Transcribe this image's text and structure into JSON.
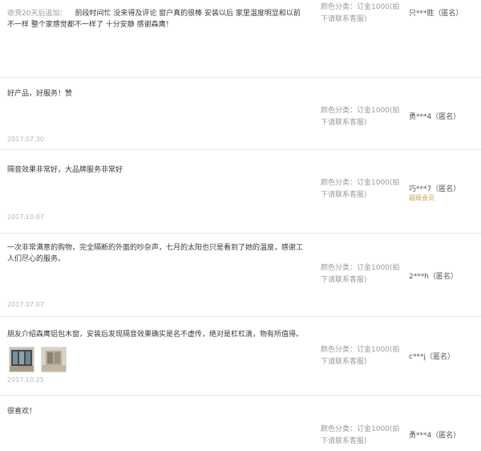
{
  "reviews": [
    {
      "appended_label": "收货20天后追加：",
      "comment": "前段时间忙 没来得及评论 窗户真的很棒 安装以后 家里温度明显和以前不一样 整个家感觉都不一样了 十分安静 感谢森鹰！",
      "sku": "颜色分类：订金1000(拍下请联系客服)",
      "user": "只***胜（匿名）"
    },
    {
      "comment": "好产品，好服务！赞",
      "date": "2017.07.30",
      "sku": "颜色分类：订金1000(拍下请联系客服)",
      "user": "勇***4（匿名）"
    },
    {
      "comment": "隔音效果非常好，大品牌服务非常好",
      "date": "2017.10.07",
      "sku": "颜色分类：订金1000(拍下请联系客服)",
      "user": "巧***7（匿名）",
      "badge": "超级会员"
    },
    {
      "comment": "一次非常满意的购物，完全隔断的外面的吵杂声，七月的太阳也只是看到了她的温度，感谢工人们尽心的服务。",
      "date": "2017.07.07",
      "sku": "颜色分类：订金1000(拍下请联系客服)",
      "user": "2***h（匿名）"
    },
    {
      "comment": "朋友介绍森鹰铝包木窗，安装后发现隔音效果确实是名不虚传，绝对是杠杠滴，物有所值得。",
      "date": "2017.10.25",
      "sku": "颜色分类：订金1000(拍下请联系客服)",
      "user": "c***j（匿名）",
      "photos": [
        "window-photo-1",
        "window-photo-2"
      ]
    },
    {
      "comment": "很喜欢！",
      "sku": "颜色分类：订金1000(拍下请联系客服)",
      "user": "勇***4（匿名）"
    }
  ]
}
